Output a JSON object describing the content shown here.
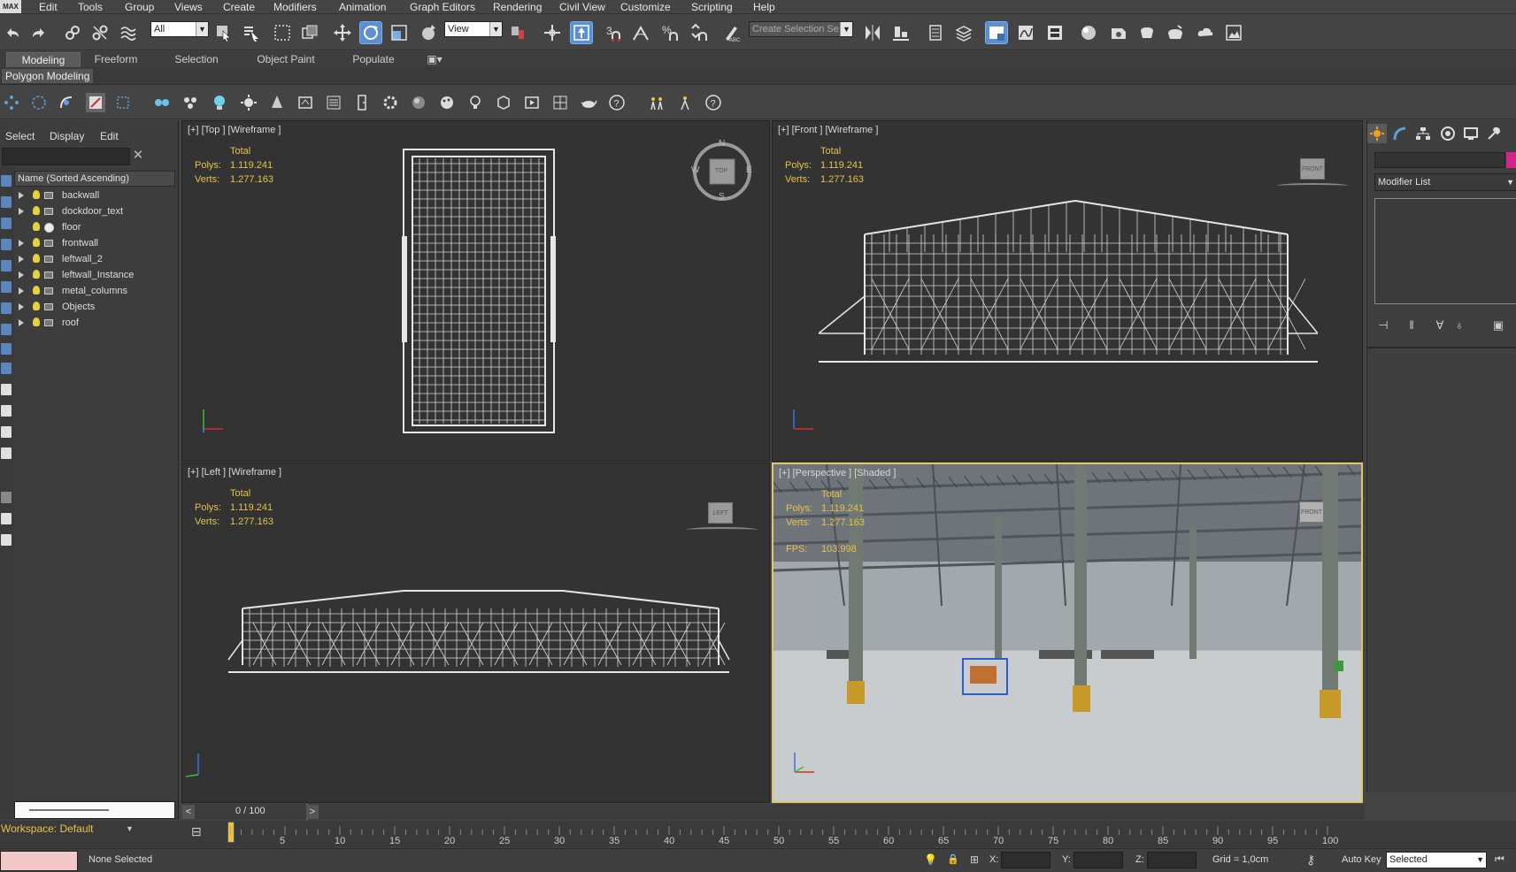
{
  "menubar": {
    "logo": "MAX",
    "items": [
      "Edit",
      "Tools",
      "Group",
      "Views",
      "Create",
      "Modifiers",
      "Animation",
      "Graph Editors",
      "Rendering",
      "Civil View",
      "Customize",
      "Scripting",
      "Help"
    ]
  },
  "toolbar": {
    "selection_filter": "All",
    "ref_coord": "View",
    "named_selection_placeholder": "Create Selection Se",
    "snap_label": "3"
  },
  "ribbon": {
    "tabs": [
      "Modeling",
      "Freeform",
      "Selection",
      "Object Paint",
      "Populate"
    ],
    "active_tab": "Modeling",
    "subpanel": "Polygon Modeling"
  },
  "scene_explorer": {
    "menus": [
      "Select",
      "Display",
      "Edit"
    ],
    "header": "Name (Sorted Ascending)",
    "items": [
      {
        "name": "backwall",
        "expandable": true
      },
      {
        "name": "dockdoor_text",
        "expandable": true
      },
      {
        "name": "floor",
        "expandable": false
      },
      {
        "name": "frontwall",
        "expandable": true
      },
      {
        "name": "leftwall_2",
        "expandable": true
      },
      {
        "name": "leftwall_Instance",
        "expandable": true
      },
      {
        "name": "metal_columns",
        "expandable": true
      },
      {
        "name": "Objects",
        "expandable": true
      },
      {
        "name": "roof",
        "expandable": true
      }
    ]
  },
  "viewports": {
    "top": {
      "label": "[+] [Top ] [Wireframe ]",
      "cube": "TOP"
    },
    "front": {
      "label": "[+] [Front ] [Wireframe ]",
      "cube": "FRONT"
    },
    "left": {
      "label": "[+] [Left ] [Wireframe ]",
      "cube": "LEFT"
    },
    "persp": {
      "label": "[+] [Perspective ] [Shaded ]",
      "cube": "FRONT"
    },
    "stats": {
      "total": "Total",
      "polys_label": "Polys:",
      "polys": "1.119.241",
      "verts_label": "Verts:",
      "verts": "1.277.163",
      "fps_label": "FPS:",
      "fps": "103.998"
    },
    "compass": {
      "n": "N",
      "s": "S",
      "e": "E",
      "w": "W"
    }
  },
  "command_panel": {
    "modifier_list": "Modifier List"
  },
  "timeline": {
    "frame": "0 / 100",
    "ticks": [
      "5",
      "10",
      "15",
      "20",
      "25",
      "30",
      "35",
      "40",
      "45",
      "50",
      "55",
      "60",
      "65",
      "70",
      "75",
      "80",
      "85",
      "90",
      "95",
      "100"
    ]
  },
  "workspace": "Workspace: Default",
  "status": {
    "selection": "None Selected",
    "x": "X:",
    "y": "Y:",
    "z": "Z:",
    "grid": "Grid = 1,0cm",
    "autokey": "Auto Key",
    "selected": "Selected"
  },
  "colors": {
    "accent": "#5b8fd0",
    "stats": "#e8c24a",
    "active_border": "#e2c46a"
  }
}
